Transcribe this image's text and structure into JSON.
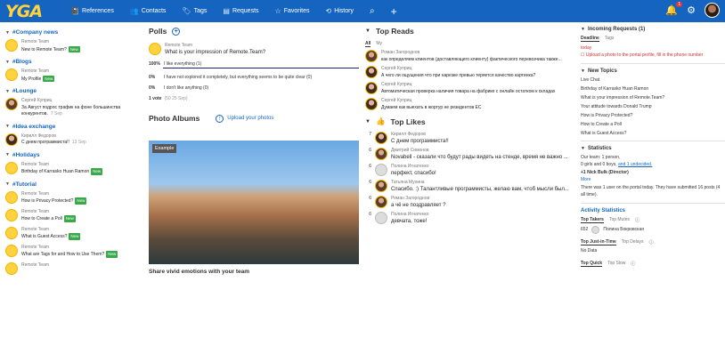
{
  "brand": {
    "logo": "YGA"
  },
  "nav": [
    {
      "icon": "📓",
      "label": "References"
    },
    {
      "icon": "👥",
      "label": "Contacts"
    },
    {
      "icon": "🏷",
      "label": "Tags"
    },
    {
      "icon": "▤",
      "label": "Requests"
    },
    {
      "icon": "☆",
      "label": "Favorites"
    },
    {
      "icon": "⟲",
      "label": "History"
    }
  ],
  "topbar": {
    "notif_count": "1"
  },
  "feed": [
    {
      "title": "#Company news",
      "items": [
        {
          "author": "Remote Team",
          "text": "New to Remote Team?",
          "new": "New"
        }
      ]
    },
    {
      "title": "#Blogs",
      "items": [
        {
          "author": "Remote Team",
          "text": "My Profile",
          "new": "New"
        }
      ]
    },
    {
      "title": "#Lounge",
      "items": [
        {
          "author": "Сергей Куприц",
          "text": "За Август подрос трафик на фоне большинства конкурентов.",
          "date": "7 Sep"
        }
      ]
    },
    {
      "title": "#Idea exchange",
      "items": [
        {
          "author": "Кирилл Федоров",
          "text": "С днем программиста!!",
          "date": "13 Sep"
        }
      ]
    },
    {
      "title": "#Holidays",
      "items": [
        {
          "author": "Remote Team",
          "text": "Birthday of Karrasko Huan Ramon",
          "new": "New"
        }
      ]
    },
    {
      "title": "#Tutorial",
      "items": [
        {
          "author": "Remote Team",
          "text": "How is Privacy Protected?",
          "new": "New"
        },
        {
          "author": "Remote Team",
          "text": "How to Create a Poll",
          "new": "New"
        },
        {
          "author": "Remote Team",
          "text": "What is Guest Access?",
          "new": "New"
        },
        {
          "author": "Remote Team",
          "text": "What are Tags for and How to Use Them?",
          "new": "New"
        },
        {
          "author": "Remote Team",
          "text": "",
          "new": ""
        }
      ]
    }
  ],
  "polls": {
    "title": "Polls",
    "author": "Remote Team",
    "question": "What is your impression of Remote.Team?",
    "options": [
      {
        "pct": "100%",
        "text": "I like everything (1)"
      },
      {
        "pct": "0%",
        "text": "I have not explored it completely, but everything seems to be quite clear (0)"
      },
      {
        "pct": "0%",
        "text": "I don't like anything (0)"
      }
    ],
    "votes": "1 vote",
    "votes_date": "(50 25 Sep)"
  },
  "albums": {
    "title": "Photo Albums",
    "upload": "Upload your photos",
    "tag": "Example",
    "caption": "Share vivid emotions with your team"
  },
  "top_reads": {
    "title": "Top Reads",
    "tabs": [
      "All",
      "My"
    ],
    "items": [
      {
        "author": "Роман Загороднов",
        "text": "как определяем клиентов (доставляющего клиенту) фактического перевозчика также..."
      },
      {
        "author": "Сергей Куприц",
        "text": "А чего ли ощущения что при нарезке превью теряется качество картинка?"
      },
      {
        "author": "Сергей Куприц",
        "text": "Автоматическая проверка наличия товара на фабрике с онлайн остатком к складах"
      },
      {
        "author": "Сергей Куприц",
        "text": "Думаем как выехать в жортур не резидентов ЕС"
      }
    ]
  },
  "top_likes": {
    "title": "Top Likes",
    "items": [
      {
        "n": "7",
        "author": "Кирилл Федоров",
        "text": "С днем программиста!!"
      },
      {
        "n": "6",
        "author": "Дмитрий Симонов",
        "text": "Novabell - сказали что будут рады видеть на стенде, время не важно ..."
      },
      {
        "n": "6",
        "author": "Полина Игнатенко",
        "text": "перфект, спасибо!"
      },
      {
        "n": "6",
        "author": "Татьяна Мухина",
        "text": "Спасибо. :) Талантливые программисты, желаю вам, чтоб мысли был..."
      },
      {
        "n": "6",
        "author": "Роман Загороднов",
        "text": "а чё не поздравляет ?"
      },
      {
        "n": "6",
        "author": "Полина Игнатенко",
        "text": "девчата, тоже!"
      }
    ]
  },
  "requests": {
    "title": "Incoming Requests (1)",
    "tabs": [
      "Deadline",
      "Tags"
    ],
    "when": "today",
    "text": "Upload a photo to the portal profile, fill in the phone number"
  },
  "new_topics": {
    "title": "New Topics",
    "items": [
      "Live Chat",
      "Birthday of Karrasko Huan Ramon",
      "What is your impression of Remote.Team?",
      "Your attitude towards Donald Trump",
      "How is Privacy Protected?",
      "How to Create a Poll",
      "What is Guest Access?"
    ]
  },
  "stats": {
    "title": "Statistics",
    "team": "Our team: 1 person,",
    "team2": "0 girls and 0 boys,",
    "team3": "and 1 undecided.",
    "nick": "+1  Nick Bulk (Director)",
    "more": "More",
    "portal": "There was 1 user on the portal today. They have submitted 16 posts (4 all time)."
  },
  "activity": {
    "title": "Activity Statistics",
    "tabs1": [
      "Top Takers",
      "Top Mutes"
    ],
    "row": "652",
    "person": "Полина Бокровская",
    "tabs2": [
      "Top Just-in-Time",
      "Top Delays"
    ],
    "nodata": "No Data",
    "tabs3": [
      "Top Quick",
      "Top Slow"
    ]
  }
}
